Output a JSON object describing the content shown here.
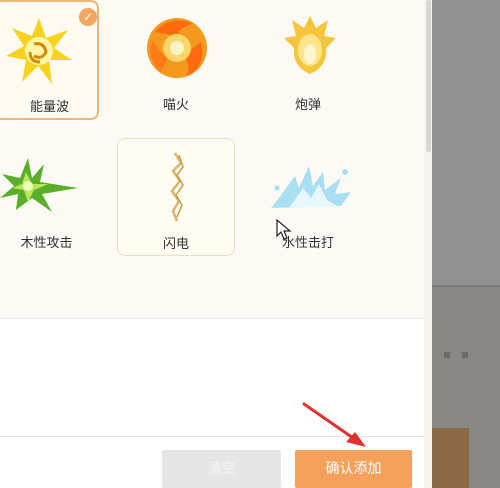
{
  "effects": [
    {
      "label": "能量波",
      "icon": "energy-wave-icon",
      "selected": true
    },
    {
      "label": "喵火",
      "icon": "fire-icon",
      "selected": false
    },
    {
      "label": "炮弹",
      "icon": "cannonball-icon",
      "selected": false
    },
    {
      "label": "木性攻击",
      "icon": "wood-attack-icon",
      "selected": false
    },
    {
      "label": "闪电",
      "icon": "lightning-icon",
      "selected": false
    },
    {
      "label": "水性击打",
      "icon": "water-strike-icon",
      "selected": false
    }
  ],
  "buttons": {
    "clear_label": "清空",
    "confirm_label": "确认添加"
  },
  "check_glyph": "✓",
  "colors": {
    "accent": "#f5a15c",
    "selected_border": "#e8b87a",
    "annotation_arrow": "#e03030"
  }
}
